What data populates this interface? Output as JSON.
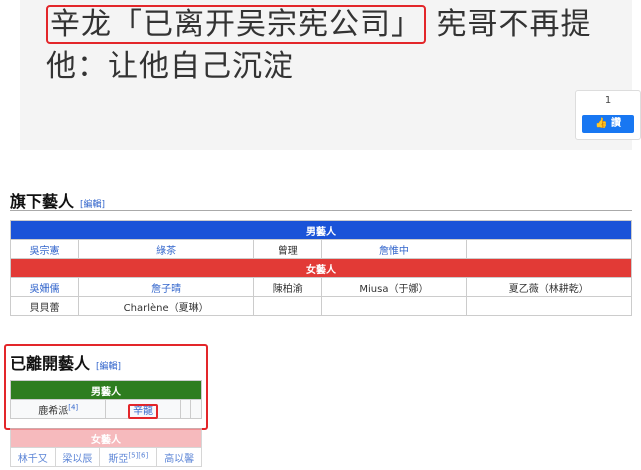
{
  "headline": {
    "boxed": "辛龙「已离开吴宗宪公司」",
    "rest": "宪哥不再提他：让他自己沉淀"
  },
  "like_widget": {
    "count": "1",
    "label": "讚"
  },
  "section1": {
    "title": "旗下藝人",
    "edit": "[編輯]",
    "male_header": "男藝人",
    "male_row": [
      "吳宗憲",
      "綠茶",
      "曾理",
      "詹惟中",
      ""
    ],
    "female_header": "女藝人",
    "female_row1": [
      "吳姍儒",
      "詹子晴",
      "陳柏渝",
      "Miusa（于娜）",
      "夏乙薇（林耕乾）"
    ],
    "female_row2": [
      "貝貝蕾",
      "Charlène（夏琳）",
      "",
      "",
      ""
    ]
  },
  "section2": {
    "title": "已離開藝人",
    "edit": "[編輯]",
    "male_header": "男藝人",
    "male_row": [
      "鹿希派",
      "辛龍",
      "",
      ""
    ],
    "male_sup": "[4]",
    "female_header": "女藝人",
    "female_row": [
      "林千又",
      "梁以辰",
      "斯亞",
      "高以馨"
    ],
    "female_sup": "[5][6]"
  },
  "colors": {
    "male_blue": "#1a53d8",
    "female_red": "#e23a36",
    "male_green": "#2e7d1f",
    "female_pink": "#f4a9ad",
    "highlight": "#e3262a"
  }
}
